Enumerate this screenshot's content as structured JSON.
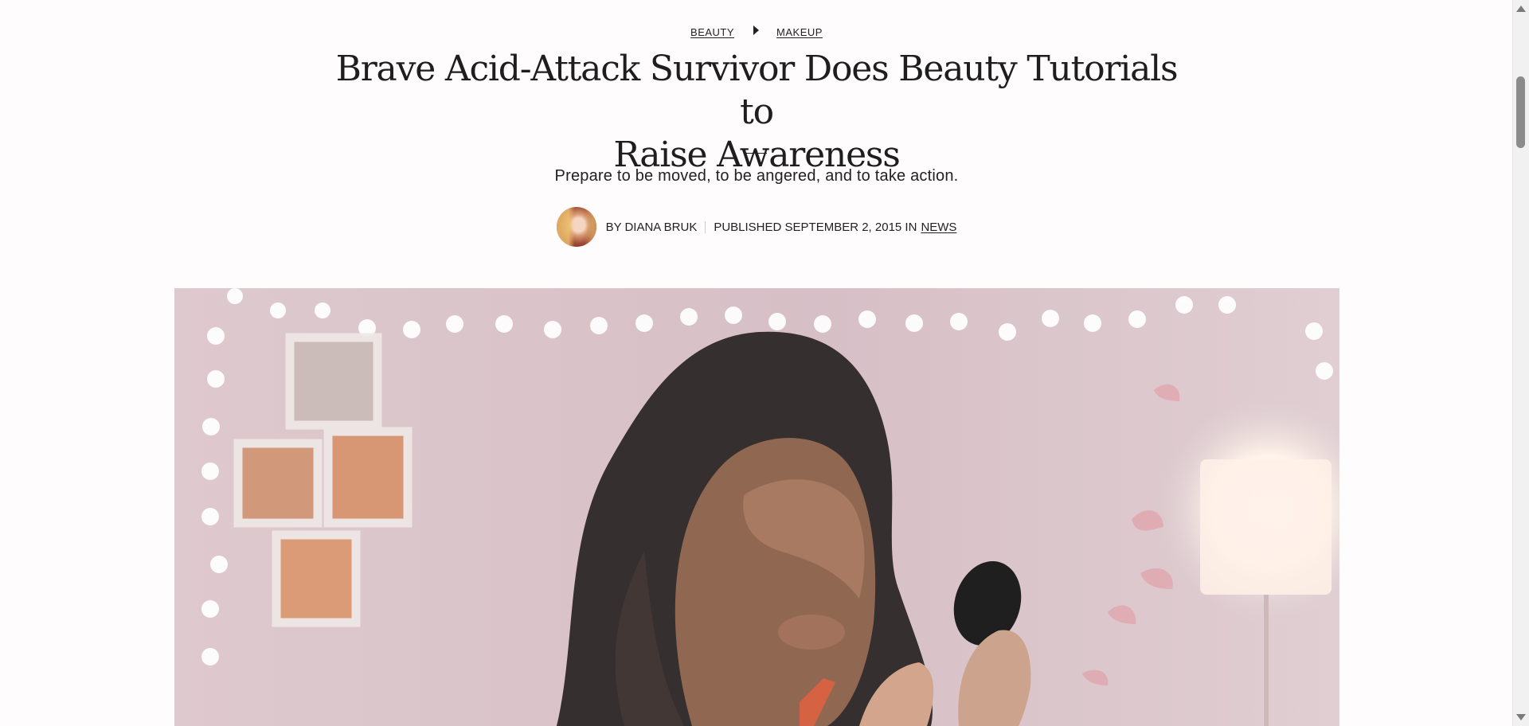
{
  "breadcrumb": {
    "items": [
      "BEAUTY",
      "MAKEUP"
    ]
  },
  "article": {
    "title_line1": "Brave Acid-Attack Survivor Does Beauty Tutorials to",
    "title_line2": "Raise Awareness",
    "dek": "Prepare to be moved, to be angered, and to take action.",
    "byline": {
      "author_prefix": "BY DIANA BRUK",
      "published": "PUBLISHED SEPTEMBER 2, 2015 IN",
      "category": "NEWS"
    }
  },
  "icons": {
    "breadcrumb_separator": "chevron-right-icon",
    "scroll_up": "scroll-up-arrow-icon",
    "scroll_down": "scroll-down-arrow-icon"
  }
}
